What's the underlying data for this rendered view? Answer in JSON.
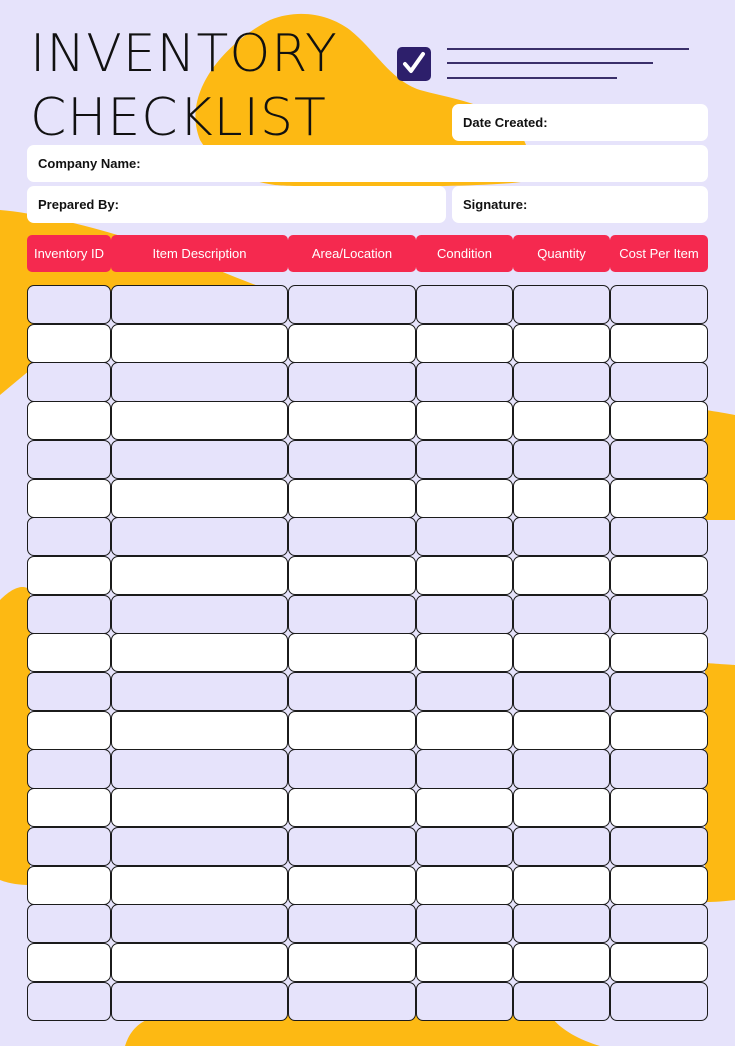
{
  "document": {
    "title_line1": "INVENTORY",
    "title_line2": "CHECKLIST",
    "icon": "checkbox-checked-icon"
  },
  "fields": {
    "date_created": "Date Created:",
    "company_name": "Company Name:",
    "prepared_by": "Prepared By:",
    "signature": "Signature:"
  },
  "table": {
    "columns": [
      "Inventory ID",
      "Item Description",
      "Area/Location",
      "Condition",
      "Quantity",
      "Cost Per Item"
    ],
    "row_count": 19,
    "rows": []
  },
  "colors": {
    "background": "#e6e3fb",
    "accent_yellow": "#fdb913",
    "header_red": "#f5294f",
    "checkbox_navy": "#2d1f6b",
    "row_alt": "#e6e3fb",
    "row_plain": "#ffffff"
  }
}
